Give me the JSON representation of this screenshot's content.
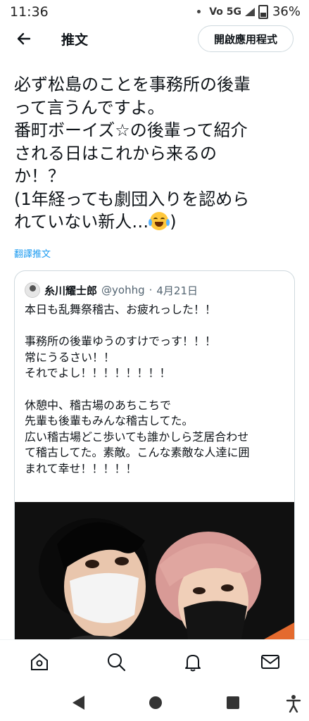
{
  "status_bar": {
    "time": "11:36",
    "network": "Vo 5G",
    "battery": "36%"
  },
  "header": {
    "title": "推文",
    "open_app_label": "開啟應用程式"
  },
  "tweet": {
    "text": "必ず松島のことを事務所の後輩\nって言うんですよ。\n番町ボーイズ☆の後輩って紹介\nされる日はこれから来るの\nか！？\n(1年経っても劇団入りを認めら\nれていない新人…",
    "text_end": ")",
    "emoji": "face-with-tears-of-joy",
    "translate_label": "翻譯推文"
  },
  "quoted_tweet": {
    "author_name": "糸川耀士郎",
    "author_handle": "@yohhg",
    "separator": "·",
    "date": "4月21日",
    "text": "本日も乱舞祭稽古、お疲れっした！！\n\n事務所の後輩ゆうのすけでっす！！！\n常にうるさい！！\nそれでよし！！！！！！！！\n\n休憩中、稽古場のあちこちで\n先輩も後輩もみんな稽古してた。\n広い稽古場どこ歩いても誰かしら芝居合わせ\nて稽古してた。素敵。こんな素敵な人達に囲\nまれて幸せ！！！！！"
  },
  "bottom_nav": {
    "items": [
      "home-icon",
      "search-icon",
      "notifications-icon",
      "messages-icon"
    ]
  },
  "system_nav": {
    "items": [
      "back-triangle-icon",
      "home-circle-icon",
      "recents-square-icon",
      "accessibility-icon"
    ]
  },
  "colors": {
    "link": "#1d9bf0",
    "text": "#0f1419",
    "secondary": "#536471",
    "border": "#cfd9de"
  }
}
